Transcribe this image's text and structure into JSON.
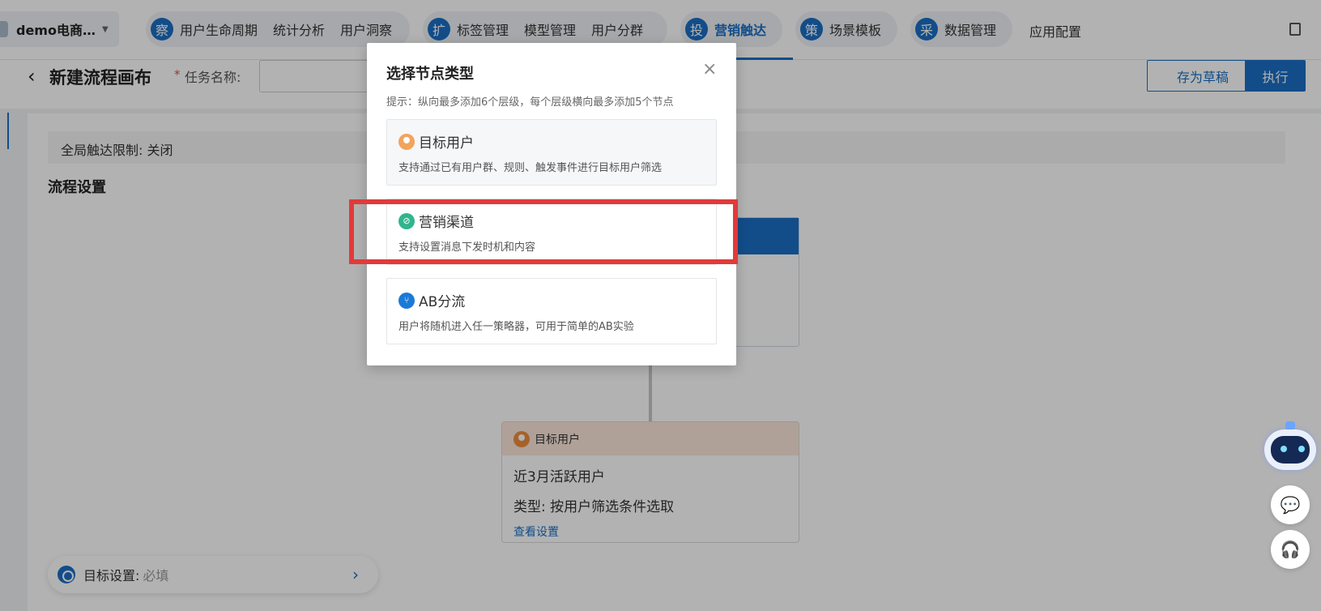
{
  "topnav": {
    "app_name": "demo电商…",
    "groups": [
      {
        "badge": "察",
        "items": [
          "用户生命周期",
          "统计分析",
          "用户洞察"
        ]
      },
      {
        "badge": "扩",
        "items": [
          "标签管理",
          "模型管理",
          "用户分群"
        ]
      },
      {
        "badge": "投",
        "items": [
          "营销触达"
        ]
      },
      {
        "badge": "策",
        "items": [
          "场景模板"
        ]
      },
      {
        "badge": "采",
        "items": [
          "数据管理"
        ]
      }
    ],
    "plain_item": "应用配置",
    "active_item": "营销触达"
  },
  "page": {
    "title": "新建流程画布",
    "required_mark": "*",
    "task_name_label": "任务名称:",
    "save_draft_label": "存为草稿",
    "execute_label": "执行"
  },
  "canvas": {
    "global_limit_label": "全局触达限制:  关闭",
    "flow_settings_title": "流程设置",
    "target_node": {
      "header": "目标用户",
      "name": "近3月活跃用户",
      "type": "类型: 按用户筛选条件选取",
      "link": "查看设置"
    },
    "goal": {
      "label": "目标设置:",
      "value": "必填"
    }
  },
  "modal": {
    "title": "选择节点类型",
    "hint": "提示：纵向最多添加6个层级，每个层级横向最多添加5个节点",
    "options": [
      {
        "title": "目标用户",
        "desc": "支持通过已有用户群、规则、触发事件进行目标用户筛选",
        "icon": "user-icon"
      },
      {
        "title": "营销渠道",
        "desc": "支持设置消息下发时机和内容",
        "icon": "channel-icon"
      },
      {
        "title": "AB分流",
        "desc": "用户将随机进入任一策略器，可用于简单的AB实验",
        "icon": "split-icon"
      }
    ]
  },
  "colors": {
    "accent": "#1a6fc4",
    "highlight": "#e23a3a"
  }
}
